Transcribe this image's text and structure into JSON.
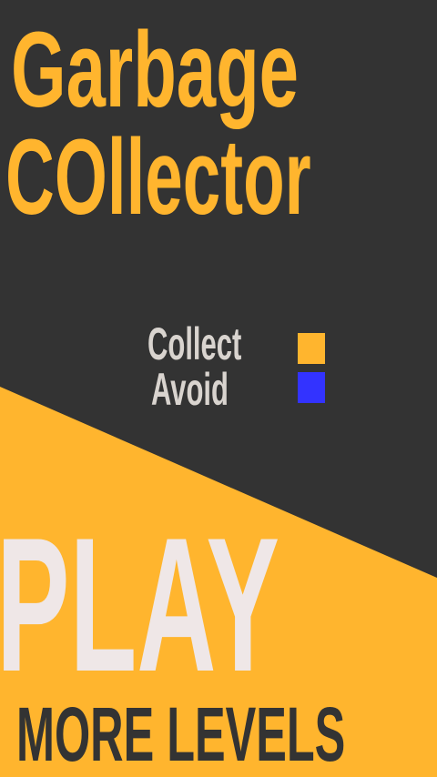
{
  "title": {
    "line1": "Garbage",
    "line2": "COllector"
  },
  "legend": {
    "collect_label": "Collect",
    "avoid_label": "Avoid",
    "collect_color": "#ffb52e",
    "avoid_color": "#3333ff"
  },
  "buttons": {
    "play_label": "PLAY",
    "more_levels_label": "MORE LEVELS"
  },
  "colors": {
    "background": "#333333",
    "accent": "#ffb52e",
    "play_text": "#efe7e7"
  }
}
